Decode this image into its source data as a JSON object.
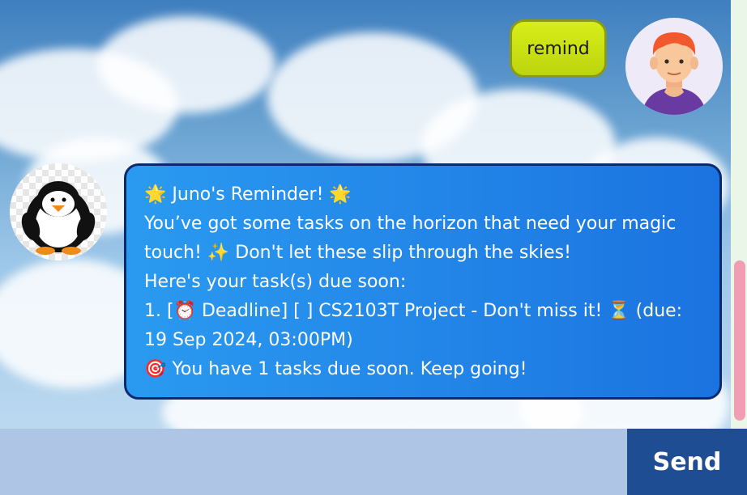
{
  "chat": {
    "user_message": "remind",
    "bot_message_lines": [
      "🌟 Juno's Reminder! 🌟",
      "You’ve got some tasks on the horizon that need your magic",
      "touch! ✨ Don't let these slip through the skies!",
      "Here's your task(s) due soon:",
      "1. [⏰ Deadline] [ ] CS2103T Project  - Don't miss it! ⏳ (due:",
      "19 Sep 2024, 03:00PM)",
      "🎯 You have 1 tasks due soon. Keep going!"
    ]
  },
  "input": {
    "value": "",
    "placeholder": ""
  },
  "send_button": {
    "label": "Send"
  },
  "icons": {
    "user_avatar": "user-avatar-icon",
    "bot_avatar": "penguin-avatar-icon"
  },
  "colors": {
    "user_bubble": "#cfe41a",
    "bot_bubble": "#1b73e0",
    "bot_bubble_border": "#0b2a6e",
    "send_button": "#1f4d94",
    "input_bar": "#afc5e5",
    "scroll_thumb": "#f19db3"
  }
}
